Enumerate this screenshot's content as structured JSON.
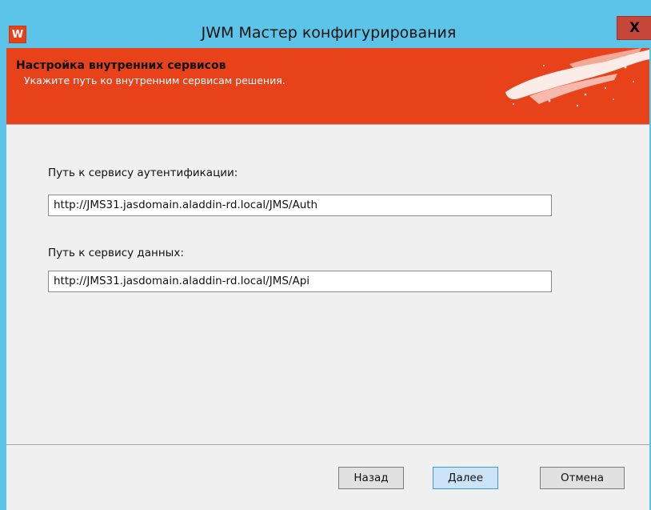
{
  "window": {
    "title": "JWM Мастер конфигурирования",
    "icon_letter": "W",
    "close_label": "X"
  },
  "banner": {
    "title": "Настройка внутренних сервисов",
    "subtitle": "Укажите путь ко внутренним сервисам решения."
  },
  "form": {
    "auth": {
      "label": "Путь к сервису аутентификации:",
      "value": "http://JMS31.jasdomain.aladdin-rd.local/JMS/Auth"
    },
    "data": {
      "label": "Путь к сервису данных:",
      "value": "http://JMS31.jasdomain.aladdin-rd.local/JMS/Api"
    }
  },
  "buttons": {
    "back": "Назад",
    "next": "Далее",
    "cancel": "Отмена"
  },
  "colors": {
    "frame": "#5bc4e8",
    "banner": "#e8421b",
    "close": "#c7463a",
    "client": "#f0f0f0"
  }
}
